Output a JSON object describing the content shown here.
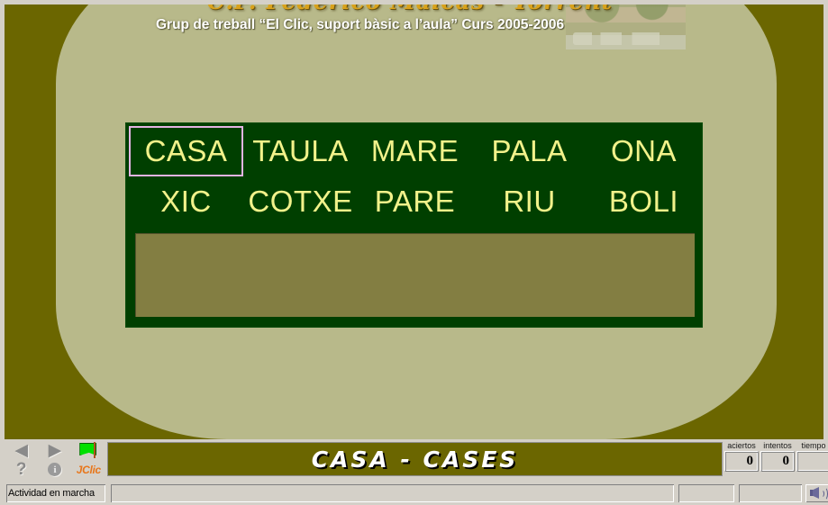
{
  "window": {
    "app": "JClic"
  },
  "header": {
    "title": "C.P. Federico Maicas - Torrent",
    "subtitle": "Grup de treball  “El Clic, suport bàsic a l’aula”  Curs 2005-2006",
    "photo_alt": "school-building-photo"
  },
  "activity": {
    "panel_bg": "#003f00",
    "word_color": "#f2f28a",
    "selection_border": "#e2b4e2",
    "answer_zone_bg": "#837e42",
    "words": [
      {
        "text": "CASA",
        "selected": true
      },
      {
        "text": "TAULA",
        "selected": false
      },
      {
        "text": "MARE",
        "selected": false
      },
      {
        "text": "PALA",
        "selected": false
      },
      {
        "text": "ONA",
        "selected": false
      },
      {
        "text": "XIC",
        "selected": false
      },
      {
        "text": "COTXE",
        "selected": false
      },
      {
        "text": "PARE",
        "selected": false
      },
      {
        "text": "RIU",
        "selected": false
      },
      {
        "text": "BOLI",
        "selected": false
      }
    ],
    "answer_zone_text": ""
  },
  "message": {
    "text": "CASA - CASES",
    "bg": "#6b6600"
  },
  "toolbar": {
    "prev_label": "◀",
    "next_label": "▶",
    "flag_label": "flag",
    "help_label": "?",
    "info_label": "i",
    "logo_label": "JClic"
  },
  "counters": [
    {
      "label": "aciertos",
      "value": "0"
    },
    {
      "label": "intentos",
      "value": "0"
    },
    {
      "label": "tiempo",
      "value": ""
    }
  ],
  "status": {
    "text": "Actividad en marcha",
    "progress_main": "",
    "progress_b": "",
    "progress_c": "",
    "speaker_label": "speaker"
  },
  "theme": {
    "desktop_bg": "#6b6600",
    "sheet_bg": "#b8b98a",
    "chrome_bg": "#d4d0c8",
    "accent_orange": "#e8761a",
    "title_gold": "#d9a21b"
  }
}
